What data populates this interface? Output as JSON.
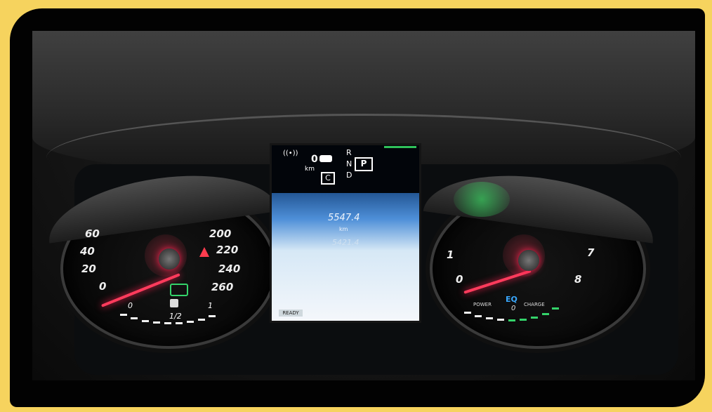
{
  "left_gauge": {
    "speed_ticks_left": [
      "60",
      "40",
      "20",
      "0"
    ],
    "speed_ticks_right": [
      "200",
      "220",
      "240",
      "260"
    ],
    "fuel_min": "0",
    "fuel_half": "1/2",
    "fuel_max": "1"
  },
  "right_gauge": {
    "ticks": [
      "1",
      "0",
      "7",
      "8"
    ],
    "brand": "EQ",
    "power_label": "POWER",
    "zero_label": "0",
    "charge_label": "CHARGE"
  },
  "center_screen": {
    "top_value": "0",
    "top_unit": "km",
    "mode_badge": "C",
    "gear_r": "R",
    "gear_n": "N",
    "gear_d": "D",
    "gear_selected": "P",
    "odometer_main": "5547.4",
    "odometer_unit": "km",
    "odometer_trip": "5421.4",
    "ready_label": "READY"
  },
  "colors": {
    "needle": "#ff3b5c",
    "eco": "#34d36a",
    "screen_blue": "#4e8fd8",
    "frame": "#f6d35e"
  },
  "icons": [
    "radio-signal-icon",
    "car-icon",
    "seatbelt-warning-icon",
    "headlight-icon",
    "fuel-pump-icon"
  ]
}
